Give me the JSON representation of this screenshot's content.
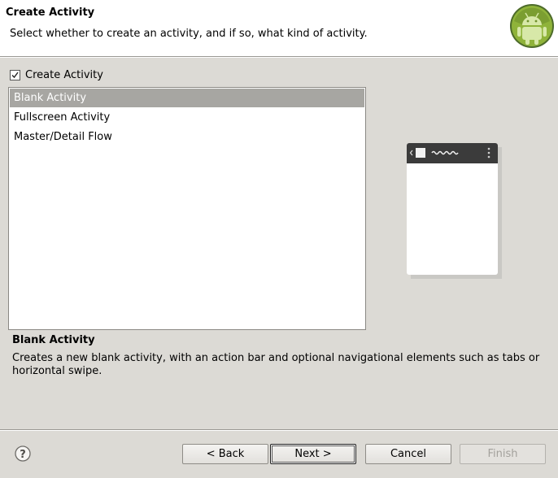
{
  "header": {
    "title": "Create Activity",
    "description": "Select whether to create an activity, and if so, what kind of activity.",
    "logo_icon": "android-logo-icon"
  },
  "create_activity": {
    "label": "Create Activity",
    "checked": true
  },
  "templates": {
    "items": [
      {
        "label": "Blank Activity",
        "selected": true
      },
      {
        "label": "Fullscreen Activity",
        "selected": false
      },
      {
        "label": "Master/Detail Flow",
        "selected": false
      }
    ]
  },
  "details": {
    "title": "Blank Activity",
    "description": "Creates a new blank activity, with an action bar and optional navigational elements such as tabs or horizontal swipe."
  },
  "buttons": {
    "back": "< Back",
    "next": "Next >",
    "cancel": "Cancel",
    "finish": "Finish"
  },
  "colors": {
    "selection": "#a7a6a2",
    "android_green": "#a4c639"
  }
}
